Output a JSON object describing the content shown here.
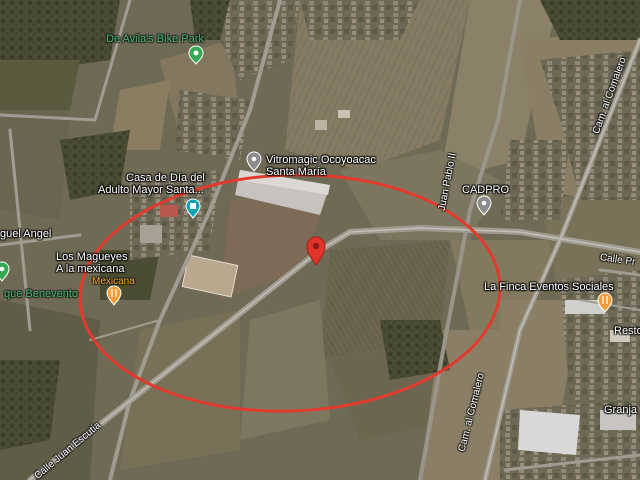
{
  "map": {
    "view": "satellite",
    "colors": {
      "field_light": "#8a7f66",
      "field_dark": "#4f5237",
      "road": "#a7a29a",
      "circle": "#e23b2e",
      "pin_red": "#e0342a",
      "poi_green": "#34a853",
      "poi_orange": "#f29d38",
      "poi_gray": "#8c8c8c",
      "poi_teal": "#12a4b5"
    }
  },
  "places": {
    "bike_park": "De Avila's Bike Park",
    "vitromagic_line1": "Vitromagic Ocoyoacac",
    "vitromagic_line2": "Santa María",
    "casa_line1": "Casa de Día del",
    "casa_line2": "Adulto Mayor Santa...",
    "cadpro": "CADPRO",
    "los_magueyes_line1": "Los Magueyes",
    "los_magueyes_line2": "A la mexicana",
    "mexicana": "Mexicana",
    "la_finca": "La Finca Eventos Sociales",
    "resto": "Resto",
    "granja": "Granja",
    "miguel_angel": "guel Angel",
    "parque_benevento": "que Benevento"
  },
  "roads": {
    "juan_pablo": "Juan Pablo II",
    "cam_comalero_top": "Cam. al Comalero",
    "cam_comalero_bottom": "Cam. al Comalero",
    "calle_pr": "Calle Pr",
    "calle_juan_escutia": "Calle Juan Escutia"
  },
  "marker": {
    "icon": "map-pin-icon"
  },
  "icons": {
    "bike_park": "tree-icon",
    "vitromagic": "location-pin-icon",
    "casa": "building-icon",
    "cadpro": "location-pin-icon",
    "los_magueyes": "restaurant-icon",
    "la_finca": "restaurant-icon",
    "parque": "park-icon"
  }
}
